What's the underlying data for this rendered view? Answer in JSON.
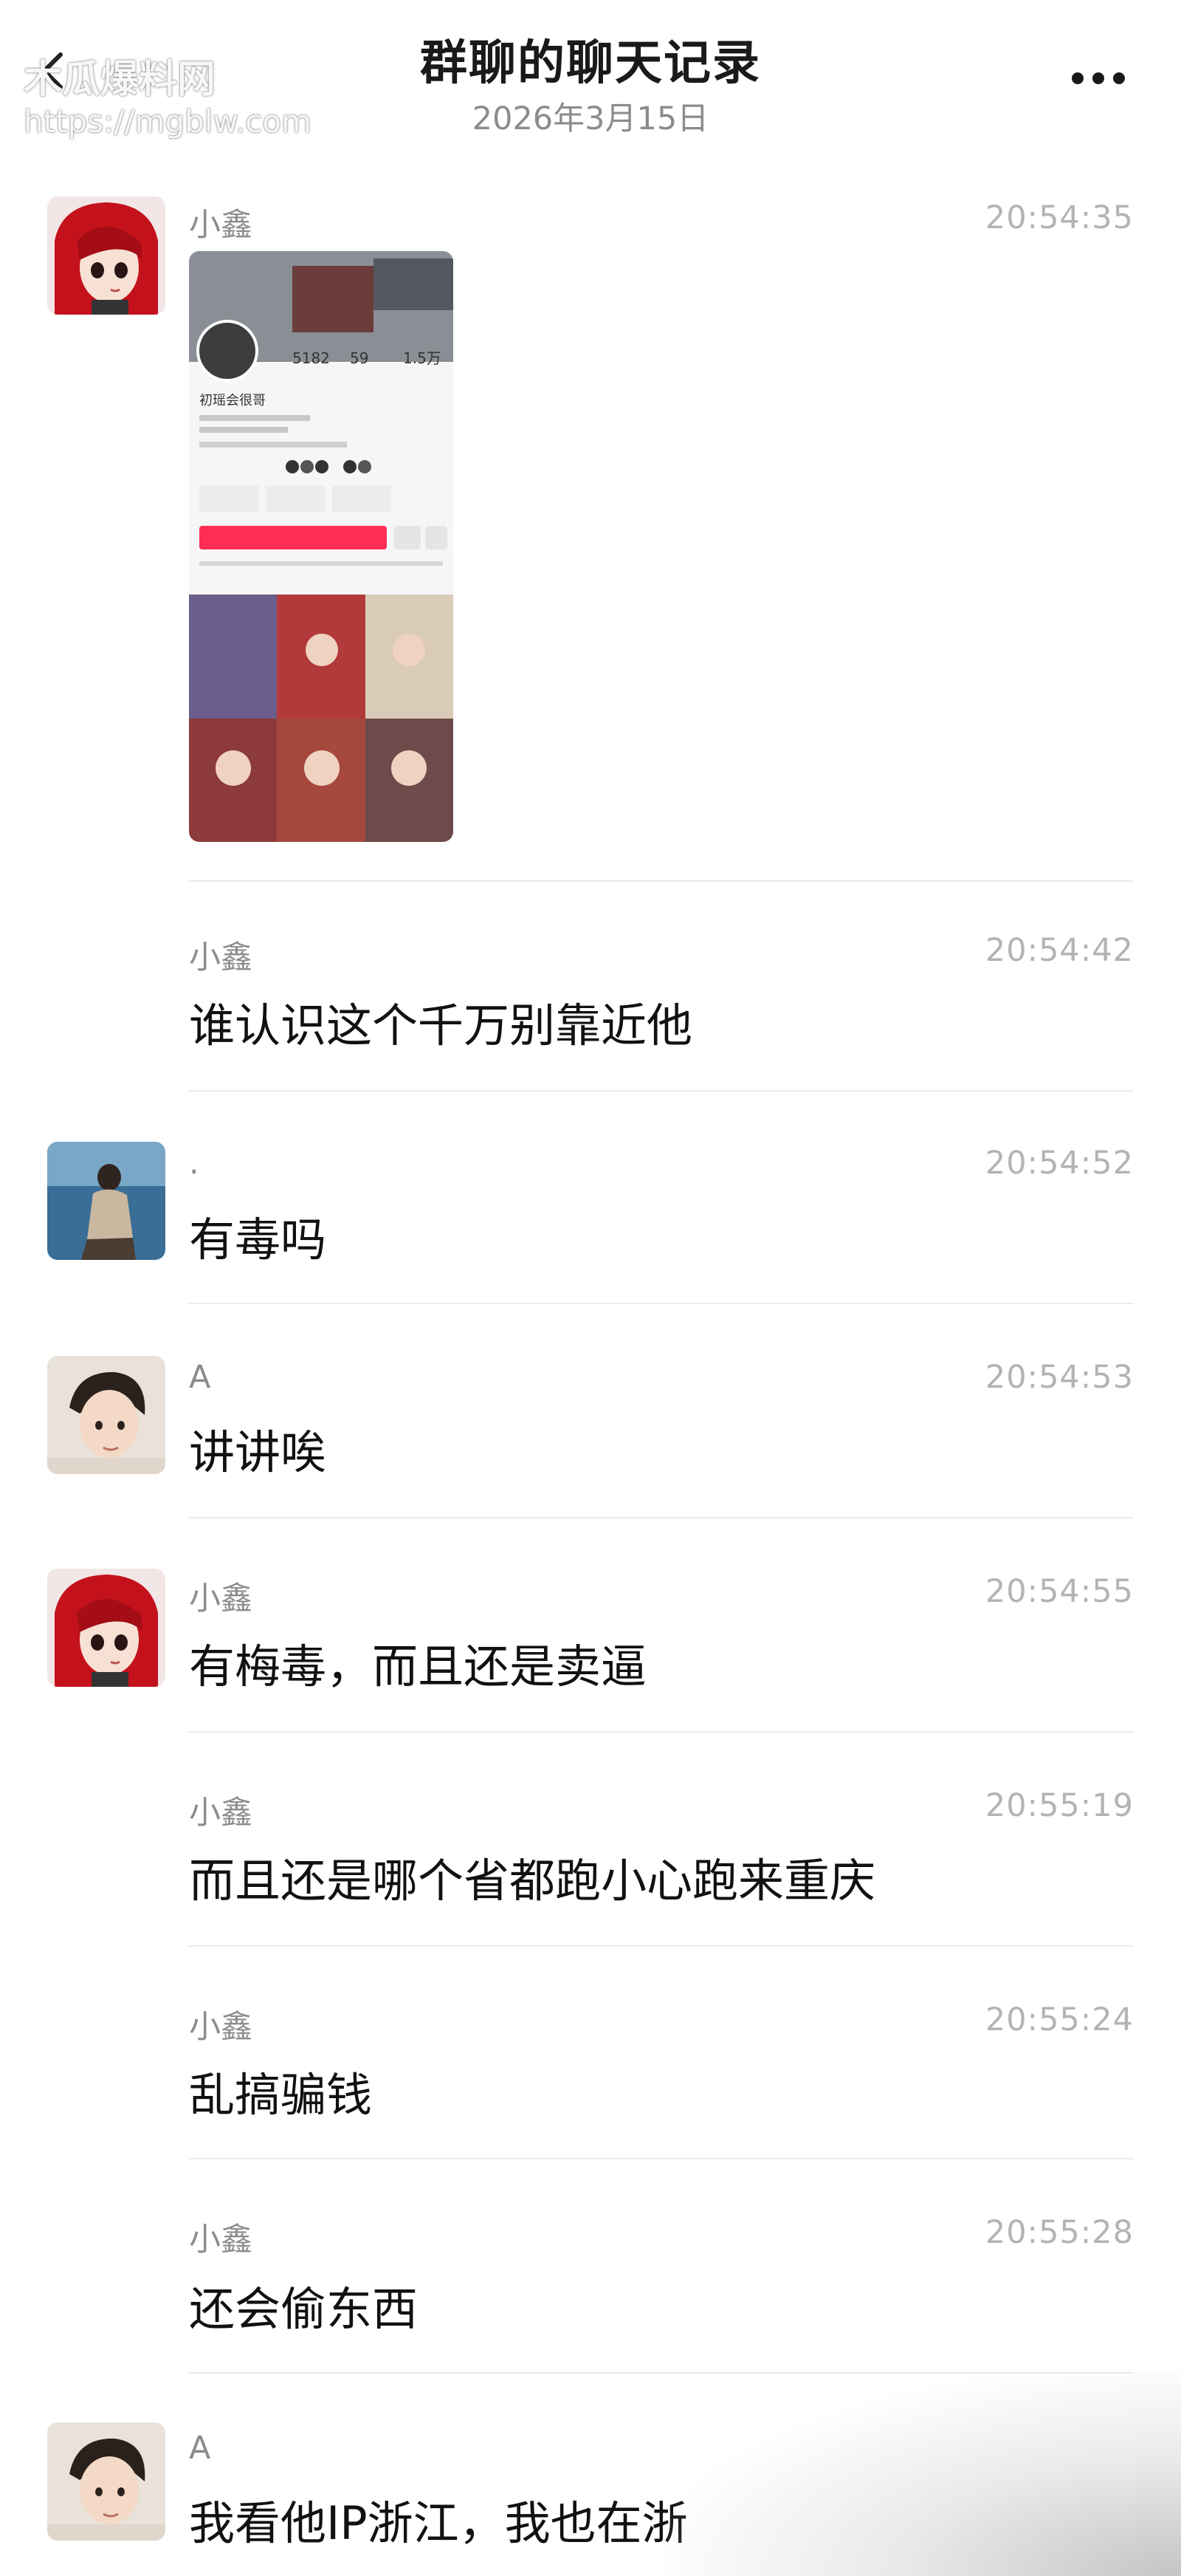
{
  "watermark": {
    "line1": "木瓜爆料网",
    "line2": "https://mgblw.com"
  },
  "header": {
    "title": "群聊的聊天记录",
    "date": "2026年3月15日",
    "back_icon": "chevron-left-icon",
    "more_icon": "more-dots-icon"
  },
  "messages": [
    {
      "sender": "小鑫",
      "time": "20:54:35",
      "text": "",
      "type": "image",
      "avatar": "red-hair-anime-avatar"
    },
    {
      "sender": "小鑫",
      "time": "20:54:42",
      "text": "谁认识这个千万别靠近他",
      "type": "text"
    },
    {
      "sender": ".",
      "time": "20:54:52",
      "text": "有毒吗",
      "type": "text",
      "avatar": "photo-avatar-person"
    },
    {
      "sender": "A",
      "time": "20:54:53",
      "text": "讲讲唉",
      "type": "text",
      "avatar": "photo-avatar-boy"
    },
    {
      "sender": "小鑫",
      "time": "20:54:55",
      "text": "有梅毒，而且还是卖逼",
      "type": "text",
      "avatar": "red-hair-anime-avatar"
    },
    {
      "sender": "小鑫",
      "time": "20:55:19",
      "text": "而且还是哪个省都跑小心跑来重庆",
      "type": "text"
    },
    {
      "sender": "小鑫",
      "time": "20:55:24",
      "text": "乱搞骗钱",
      "type": "text"
    },
    {
      "sender": "小鑫",
      "time": "20:55:28",
      "text": "还会偷东西",
      "type": "text"
    },
    {
      "sender": "A",
      "time": "",
      "text": "我看他IP浙江，我也在浙",
      "type": "text",
      "avatar": "photo-avatar-boy"
    }
  ],
  "profile_screenshot": {
    "stats": [
      "5182",
      "59",
      "1.5万"
    ],
    "name": "初瑶会很哥"
  },
  "colors": {
    "accent_pink": "#ff2d55",
    "divider": "#ebebeb",
    "muted_text": "#8c8c8c"
  }
}
